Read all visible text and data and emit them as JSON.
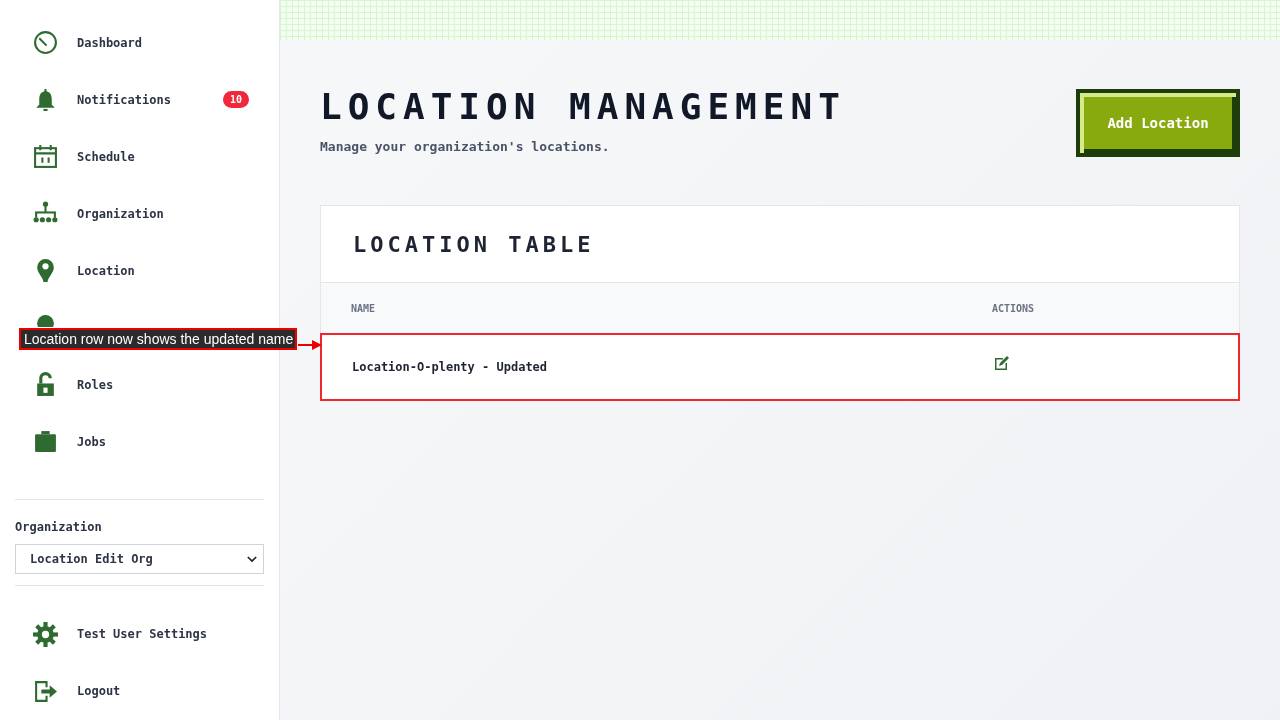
{
  "sidebar": {
    "items": [
      {
        "label": "Dashboard",
        "kind": "gauge"
      },
      {
        "label": "Notifications",
        "kind": "bell",
        "badge": "10"
      },
      {
        "label": "Schedule",
        "kind": "calendar"
      },
      {
        "label": "Organization",
        "kind": "tree"
      },
      {
        "label": "Location",
        "kind": "pin"
      },
      {
        "kind": "person"
      },
      {
        "label": "Roles",
        "kind": "lock"
      },
      {
        "label": "Jobs",
        "kind": "briefcase"
      }
    ],
    "organization": {
      "label": "Organization",
      "value": "Location Edit Org"
    },
    "footer_items": [
      {
        "label": "Test User Settings",
        "kind": "gear"
      },
      {
        "label": "Logout",
        "kind": "exit"
      }
    ]
  },
  "page": {
    "title": "LOCATION MANAGEMENT",
    "subtitle": "Manage your organization's locations.",
    "add_button": "Add Location"
  },
  "table": {
    "title": "LOCATION TABLE",
    "columns": [
      "NAME",
      "ACTIONS"
    ],
    "rows": [
      {
        "name": "Location-O-plenty - Updated",
        "highlighted": true
      }
    ]
  },
  "annotation": {
    "label": "Location row now shows the updated name"
  }
}
